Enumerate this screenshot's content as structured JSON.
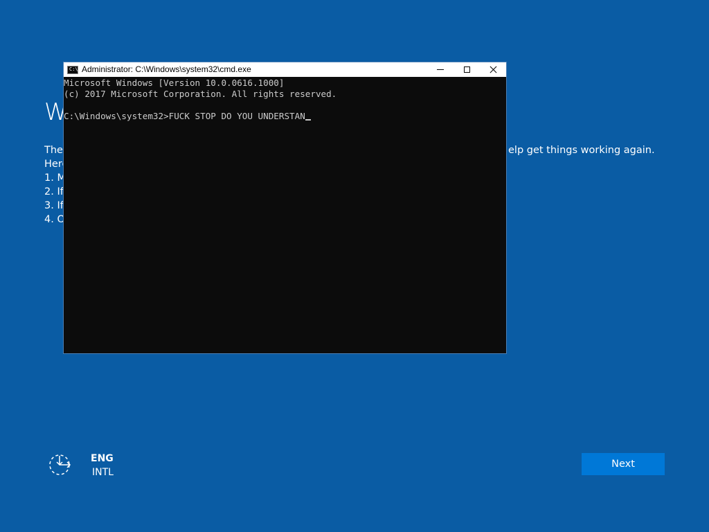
{
  "background": {
    "heading_fragment": "W",
    "text_lines": [
      "Ther",
      "Here",
      "1. M",
      "2. If",
      "3. If",
      "4. O"
    ],
    "text_right_fragment": "elp get things working again."
  },
  "console": {
    "title": "Administrator: C:\\Windows\\system32\\cmd.exe",
    "icon_text": "C:\\",
    "lines": [
      "Microsoft Windows [Version 10.0.0616.1000]",
      "(c) 2017 Microsoft Corporation. All rights reserved.",
      "",
      "C:\\Windows\\system32>FUCK STOP DO YOU UNDERSTAN"
    ]
  },
  "footer": {
    "lang_primary": "ENG",
    "lang_secondary": "INTL",
    "next_label": "Next",
    "accessibility_icon": "ease-of-access-icon"
  },
  "colors": {
    "background": "#0a5ca4",
    "console_bg": "#0c0c0c",
    "console_text": "#cccccc",
    "next_button": "#0078d7"
  }
}
